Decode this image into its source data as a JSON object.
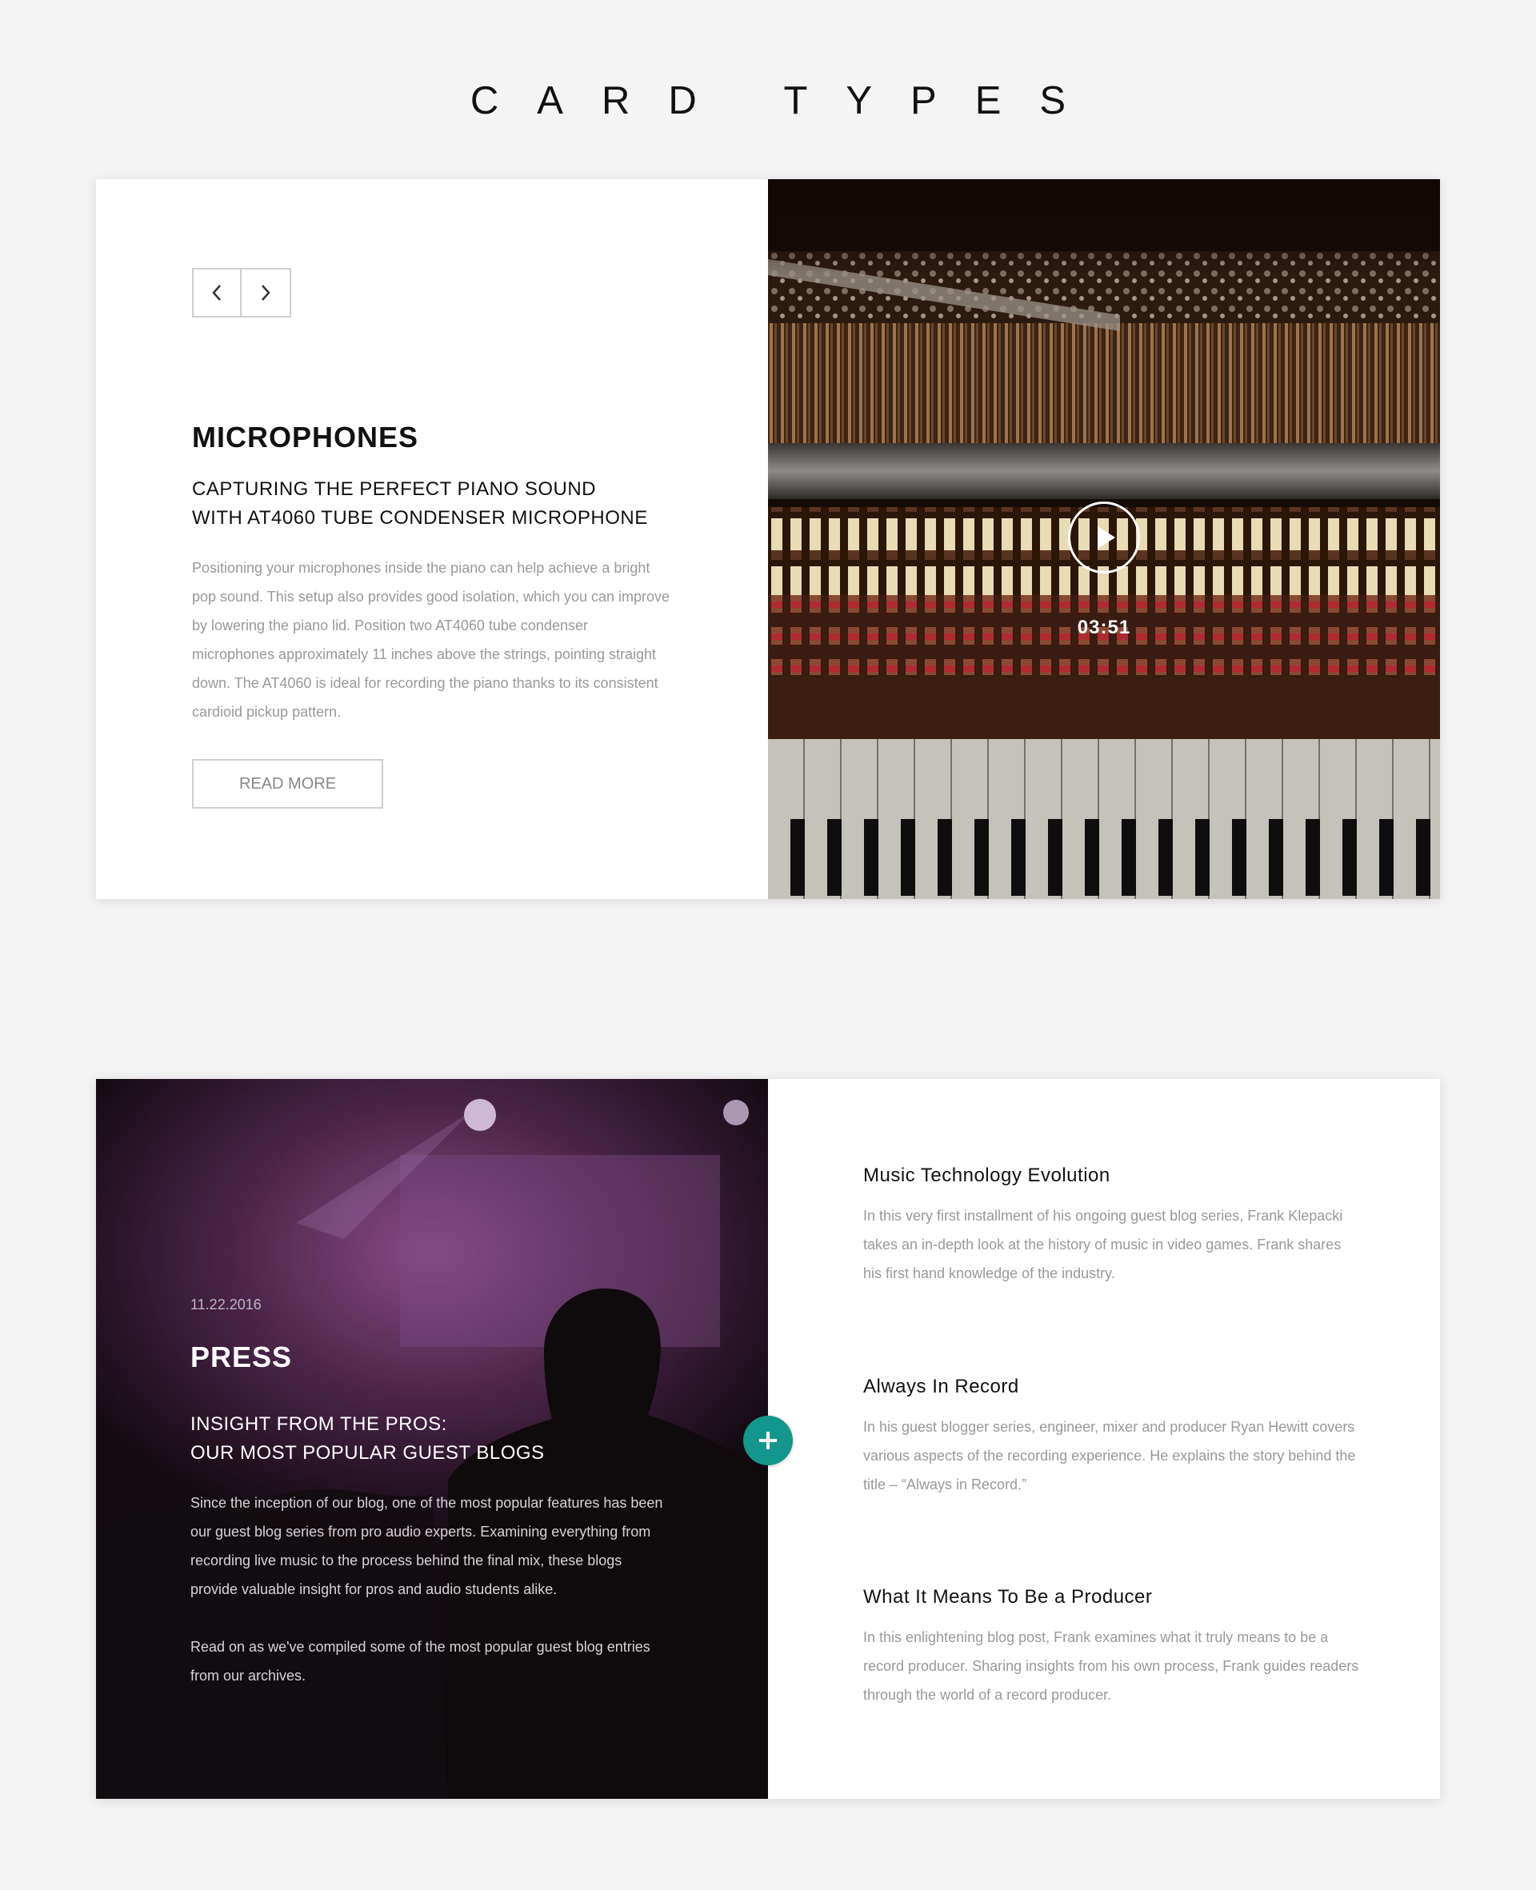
{
  "page": {
    "title": "CARD TYPES"
  },
  "colors": {
    "accent": "#13968c",
    "body_text": "#999999",
    "border": "#cfcfcf"
  },
  "card1": {
    "pager": {
      "prev_icon": "chevron-left-icon",
      "next_icon": "chevron-right-icon"
    },
    "category": "MICROPHONES",
    "subtitle_line1": "CAPTURING THE PERFECT PIANO SOUND",
    "subtitle_line2": "WITH AT4060 TUBE CONDENSER MICROPHONE",
    "body": "Positioning your microphones inside the piano can help achieve a bright pop sound. This setup also provides good isolation, which you can improve by lowering the piano lid. Position two AT4060 tube condenser microphones approximately 11 inches above the strings, pointing straight down. The AT4060 is ideal for recording the piano thanks to its consistent cardioid pickup pattern.",
    "read_more": "READ MORE",
    "video": {
      "duration": "03:51",
      "play_icon": "play-icon"
    }
  },
  "card2": {
    "date": "11.22.2016",
    "category": "PRESS",
    "subtitle_line1": "INSIGHT FROM THE PROS:",
    "subtitle_line2": "OUR MOST POPULAR GUEST BLOGS",
    "body_p1": "Since the inception of our blog, one of the most popular features has been our guest blog series from pro audio experts. Examining everything from recording live music to the process behind the final mix, these blogs provide valuable insight for pros and audio students alike.",
    "body_p2": "Read on as we've compiled some of the most popular guest blog entries from our archives.",
    "plus_icon": "plus-icon",
    "posts": [
      {
        "title": "Music Technology Evolution",
        "body": "In this very first installment of his ongoing guest blog series, Frank Klepacki takes an in-depth look at the history of music in video games. Frank shares his first hand knowledge of the industry."
      },
      {
        "title": "Always In Record",
        "body": "In his guest blogger series, engineer, mixer and producer Ryan Hewitt covers various aspects of the recording experience. He explains the story behind the title – “Always in Record.”"
      },
      {
        "title": "What It Means To Be a Producer",
        "body": "In this enlightening blog post, Frank examines what it truly means to be a record producer. Sharing insights from his own process, Frank guides readers through the world of a record producer."
      }
    ]
  }
}
